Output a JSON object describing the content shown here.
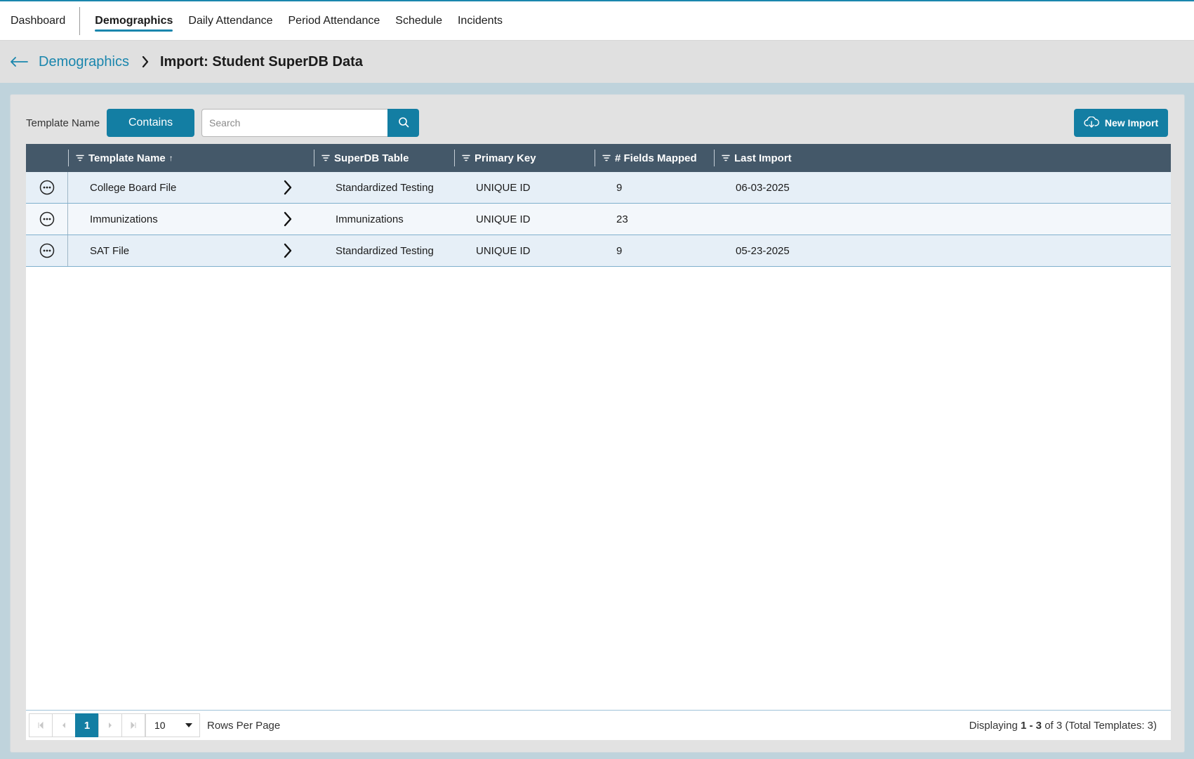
{
  "nav": {
    "items": [
      {
        "label": "Dashboard",
        "active": false
      },
      {
        "label": "Demographics",
        "active": true
      },
      {
        "label": "Daily Attendance",
        "active": false
      },
      {
        "label": "Period Attendance",
        "active": false
      },
      {
        "label": "Schedule",
        "active": false
      },
      {
        "label": "Incidents",
        "active": false
      }
    ]
  },
  "breadcrumb": {
    "back_icon": "arrow-left-icon",
    "parent": "Demographics",
    "separator_icon": "chevron-right-icon",
    "current": "Import: Student SuperDB Data"
  },
  "toolbar": {
    "filter_label": "Template Name",
    "operator": "Contains",
    "search_placeholder": "Search",
    "search_value": "",
    "new_import_label": "New Import"
  },
  "table": {
    "columns": [
      {
        "label": "Template Name",
        "sort": "↑"
      },
      {
        "label": "SuperDB Table"
      },
      {
        "label": "Primary Key"
      },
      {
        "label": "# Fields Mapped"
      },
      {
        "label": "Last Import"
      }
    ],
    "rows": [
      {
        "template_name": "College Board File",
        "superdb_table": "Standardized Testing",
        "primary_key": "UNIQUE ID",
        "fields_mapped": "9",
        "last_import": "06-03-2025"
      },
      {
        "template_name": "Immunizations",
        "superdb_table": "Immunizations",
        "primary_key": "UNIQUE ID",
        "fields_mapped": "23",
        "last_import": ""
      },
      {
        "template_name": "SAT File",
        "superdb_table": "Standardized Testing",
        "primary_key": "UNIQUE ID",
        "fields_mapped": "9",
        "last_import": "05-23-2025"
      }
    ]
  },
  "pager": {
    "current_page": "1",
    "page_size": "10",
    "rows_per_page_label": "Rows Per Page",
    "display_prefix": "Displaying",
    "display_range": "1 - 3",
    "display_of": "of",
    "display_total": "3 (Total Templates: 3)"
  },
  "colors": {
    "accent": "#137ea3",
    "header_bg": "#445869",
    "row_odd": "#e6eff7",
    "row_even": "#f3f7fb",
    "page_bg": "#bfd3dc"
  }
}
